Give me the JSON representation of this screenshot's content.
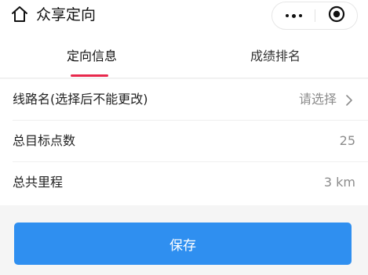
{
  "header": {
    "title": "众享定向"
  },
  "tabs": [
    {
      "label": "定向信息",
      "active": true
    },
    {
      "label": "成绩排名",
      "active": false
    }
  ],
  "form": {
    "route": {
      "label": "线路名(选择后不能更改)",
      "placeholder": "请选择"
    },
    "total_points": {
      "label": "总目标点数",
      "value": "25"
    },
    "total_distance": {
      "label": "总共里程",
      "value": "3 km"
    }
  },
  "actions": {
    "save_label": "保存"
  },
  "colors": {
    "accent": "#e8284c",
    "primary_button": "#2f8ff0"
  },
  "icons": [
    "home-icon",
    "more-icon",
    "close-target-icon",
    "chevron-right-icon"
  ]
}
